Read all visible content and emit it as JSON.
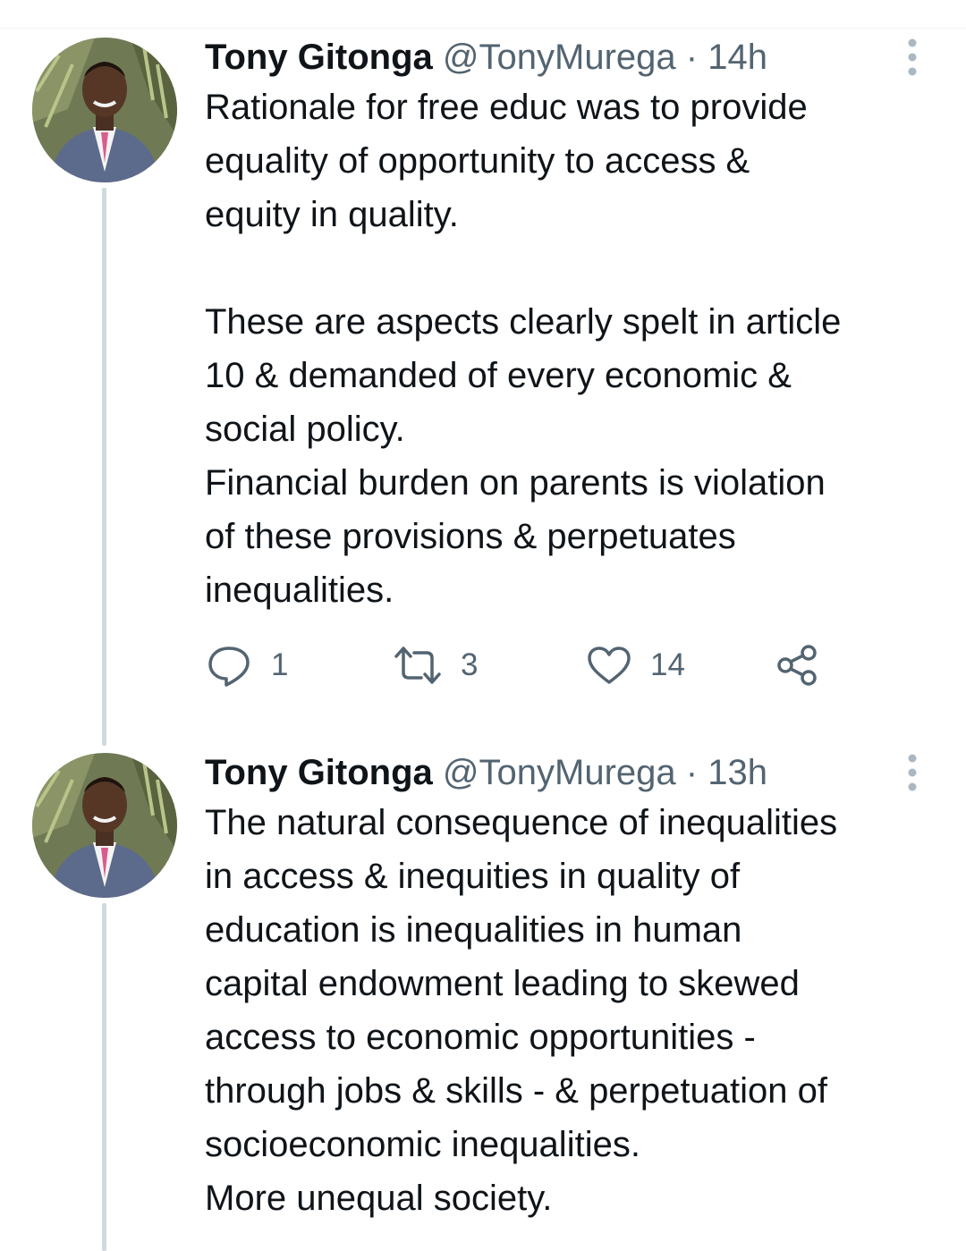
{
  "thread": [
    {
      "author_name": "Tony Gitonga",
      "author_handle": "@TonyMurega",
      "separator": "·",
      "timestamp": "14h",
      "text": "Rationale for free educ was to provide\nequality of opportunity to access &\nequity in quality.\n\nThese are aspects clearly spelt in article\n10 & demanded of every economic &\nsocial policy.\nFinancial burden on parents is violation\nof these provisions & perpetuates\ninequalities.",
      "reply_count": "1",
      "retweet_count": "3",
      "like_count": "14"
    },
    {
      "author_name": "Tony Gitonga",
      "author_handle": "@TonyMurega",
      "separator": "·",
      "timestamp": "13h",
      "text": "The natural consequence of inequalities\nin access & inequities in quality of\neducation is inequalities in human\ncapital endowment leading to skewed\naccess to economic opportunities -\nthrough jobs & skills - & perpetuation of\nsocioeconomic inequalities.\nMore unequal society."
    }
  ],
  "icons": {
    "more": "more-vertical-icon",
    "reply": "reply-icon",
    "retweet": "retweet-icon",
    "like": "heart-icon",
    "share": "share-icon"
  },
  "colors": {
    "text_primary": "#0f1419",
    "text_secondary": "#536471",
    "thread_line": "#cfd9de",
    "more_dots": "#aab8c2"
  }
}
